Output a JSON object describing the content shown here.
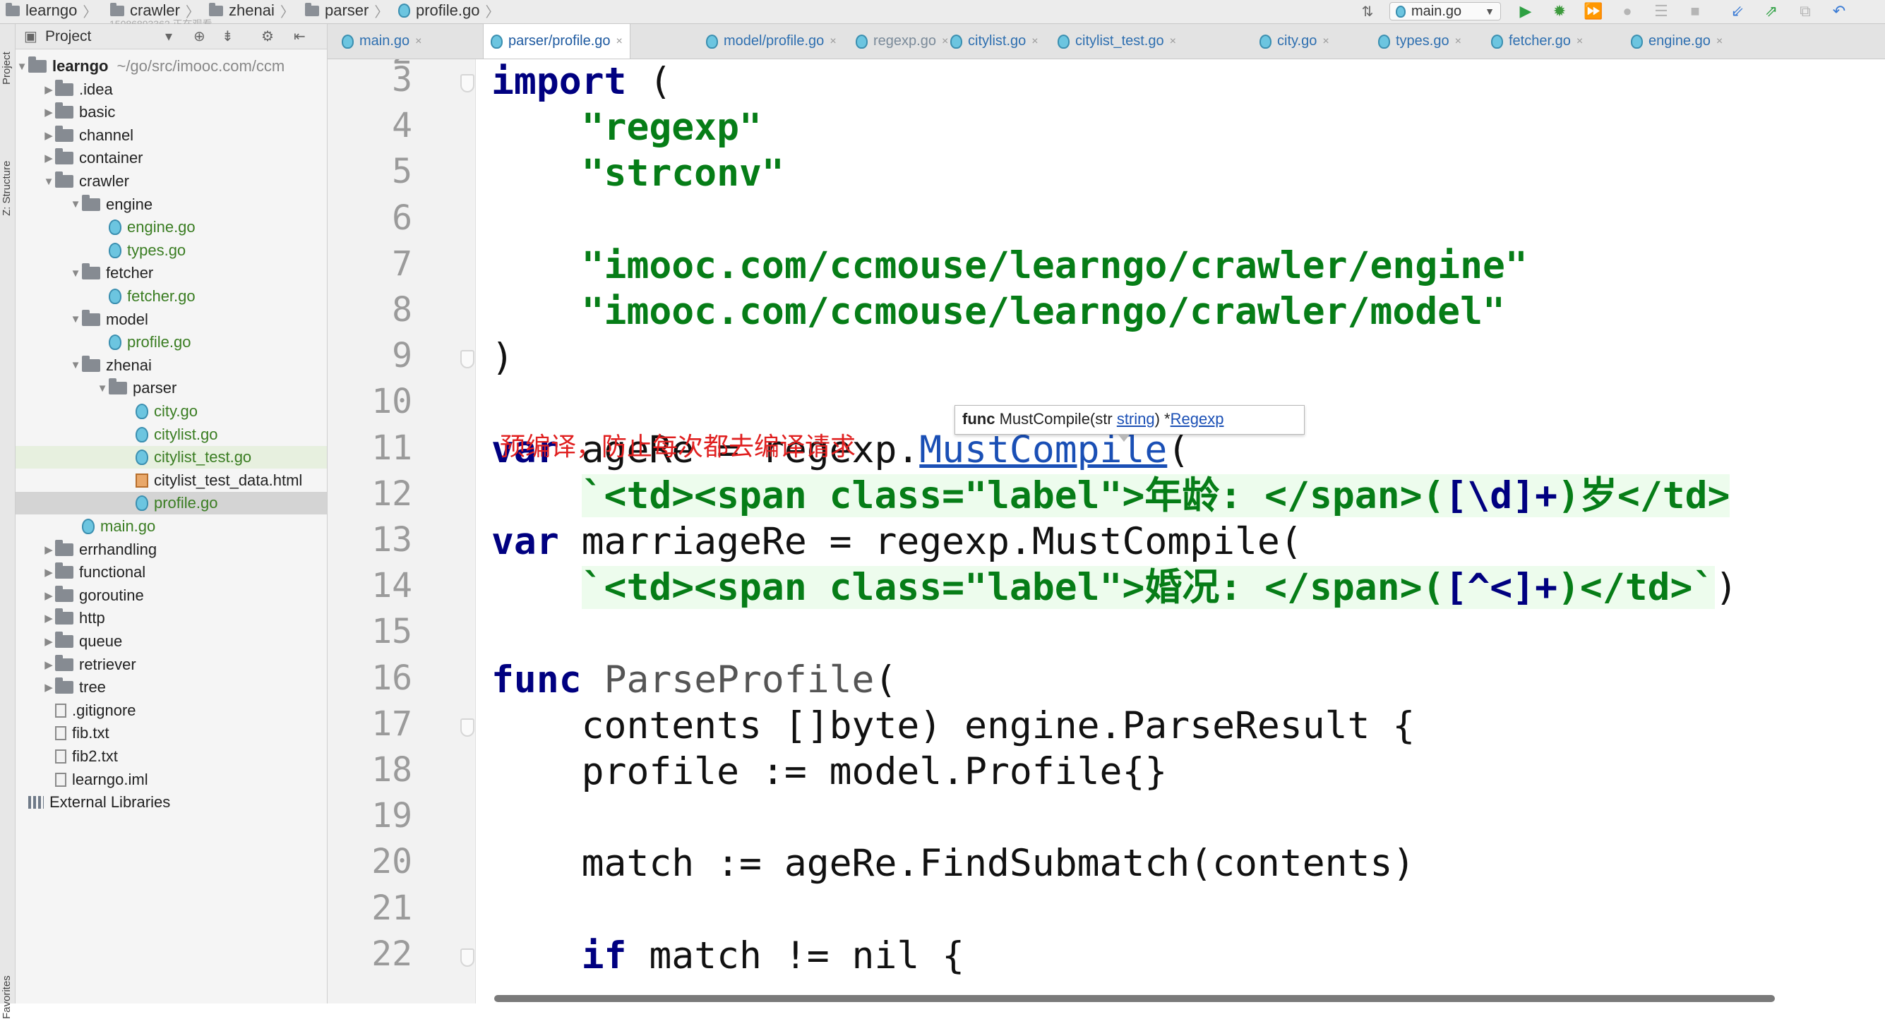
{
  "breadcrumb": {
    "items": [
      "learngo",
      "crawler",
      "zhenai",
      "parser"
    ],
    "file": "profile.go",
    "sub_text": "15086893362 正在观看"
  },
  "toolbar": {
    "run_config": "main.go",
    "buttons": [
      "run-icon",
      "debug-icon",
      "coverage-icon",
      "profile-icon",
      "build-icon",
      "stop-icon",
      "vcs-update-icon",
      "vcs-commit-icon",
      "history-icon",
      "revert-icon"
    ]
  },
  "left_strip": {
    "top_labels": [
      "Project",
      "Z: Structure"
    ],
    "bottom_label": "Favorites"
  },
  "project_panel": {
    "title": "Project",
    "tree": [
      {
        "label": "learngo",
        "extra": "~/go/src/imooc.com/ccm",
        "type": "root",
        "depth": 0,
        "expanded": true
      },
      {
        "label": ".idea",
        "type": "folder",
        "depth": 1,
        "expanded": false
      },
      {
        "label": "basic",
        "type": "folder",
        "depth": 1,
        "expanded": false
      },
      {
        "label": "channel",
        "type": "folder",
        "depth": 1,
        "expanded": false
      },
      {
        "label": "container",
        "type": "folder",
        "depth": 1,
        "expanded": false
      },
      {
        "label": "crawler",
        "type": "folder",
        "depth": 1,
        "expanded": true
      },
      {
        "label": "engine",
        "type": "folder",
        "depth": 2,
        "expanded": true
      },
      {
        "label": "engine.go",
        "type": "go",
        "depth": 3
      },
      {
        "label": "types.go",
        "type": "go",
        "depth": 3
      },
      {
        "label": "fetcher",
        "type": "folder",
        "depth": 2,
        "expanded": true
      },
      {
        "label": "fetcher.go",
        "type": "go",
        "depth": 3
      },
      {
        "label": "model",
        "type": "folder",
        "depth": 2,
        "expanded": true
      },
      {
        "label": "profile.go",
        "type": "go",
        "depth": 3
      },
      {
        "label": "zhenai",
        "type": "folder",
        "depth": 2,
        "expanded": true
      },
      {
        "label": "parser",
        "type": "folder",
        "depth": 3,
        "expanded": true
      },
      {
        "label": "city.go",
        "type": "go",
        "depth": 4
      },
      {
        "label": "citylist.go",
        "type": "go",
        "depth": 4
      },
      {
        "label": "citylist_test.go",
        "type": "go",
        "depth": 4,
        "highlight": true
      },
      {
        "label": "citylist_test_data.html",
        "type": "html",
        "depth": 4
      },
      {
        "label": "profile.go",
        "type": "go",
        "depth": 4,
        "selected": true
      },
      {
        "label": "main.go",
        "type": "go",
        "depth": 2
      },
      {
        "label": "errhandling",
        "type": "folder",
        "depth": 1,
        "expanded": false
      },
      {
        "label": "functional",
        "type": "folder",
        "depth": 1,
        "expanded": false
      },
      {
        "label": "goroutine",
        "type": "folder",
        "depth": 1,
        "expanded": false
      },
      {
        "label": "http",
        "type": "folder",
        "depth": 1,
        "expanded": false
      },
      {
        "label": "queue",
        "type": "folder",
        "depth": 1,
        "expanded": false
      },
      {
        "label": "retriever",
        "type": "folder",
        "depth": 1,
        "expanded": false
      },
      {
        "label": "tree",
        "type": "folder",
        "depth": 1,
        "expanded": false
      },
      {
        "label": ".gitignore",
        "type": "file",
        "depth": 1
      },
      {
        "label": "fib.txt",
        "type": "file",
        "depth": 1
      },
      {
        "label": "fib2.txt",
        "type": "file",
        "depth": 1
      },
      {
        "label": "learngo.iml",
        "type": "file",
        "depth": 1
      },
      {
        "label": "External Libraries",
        "type": "lib",
        "depth": 0
      }
    ]
  },
  "tabs": [
    {
      "label": "main.go"
    },
    {
      "label": "parser/profile.go",
      "active": true
    },
    {
      "label": "model/profile.go"
    },
    {
      "label": "regexp.go"
    },
    {
      "label": "citylist.go"
    },
    {
      "label": "citylist_test.go"
    },
    {
      "label": "city.go"
    },
    {
      "label": "types.go"
    },
    {
      "label": "fetcher.go"
    },
    {
      "label": "engine.go"
    }
  ],
  "editor": {
    "partial_top_line": "2",
    "line_numbers": [
      "3",
      "4",
      "5",
      "6",
      "7",
      "8",
      "9",
      "10",
      "11",
      "12",
      "13",
      "14",
      "15",
      "16",
      "17",
      "18",
      "19",
      "20",
      "21",
      "22"
    ],
    "annotation_comment": "预编译，防止每次都去编译请求",
    "tooltip": {
      "prefix": "func",
      "name": " MustCompile(str ",
      "param_type": "string",
      "mid": ") *",
      "return_type": "Regexp"
    },
    "lines": [
      {
        "n": "3",
        "parts": [
          {
            "t": "import",
            "c": "kw"
          },
          {
            "t": " (",
            "c": ""
          }
        ]
      },
      {
        "n": "4",
        "parts": [
          {
            "t": "    ",
            "c": ""
          },
          {
            "t": "\"regexp\"",
            "c": "str"
          }
        ]
      },
      {
        "n": "5",
        "parts": [
          {
            "t": "    ",
            "c": ""
          },
          {
            "t": "\"strconv\"",
            "c": "str"
          }
        ]
      },
      {
        "n": "6",
        "parts": []
      },
      {
        "n": "7",
        "parts": [
          {
            "t": "    ",
            "c": ""
          },
          {
            "t": "\"imooc.com/ccmouse/learngo/crawler/engine\"",
            "c": "str"
          }
        ]
      },
      {
        "n": "8",
        "parts": [
          {
            "t": "    ",
            "c": ""
          },
          {
            "t": "\"imooc.com/ccmouse/learngo/crawler/model\"",
            "c": "str"
          }
        ]
      },
      {
        "n": "9",
        "parts": [
          {
            "t": ")",
            "c": ""
          }
        ]
      },
      {
        "n": "10",
        "parts": []
      },
      {
        "n": "11",
        "parts": [
          {
            "t": "var",
            "c": "kw"
          },
          {
            "t": " ageRe = regexp.",
            "c": ""
          },
          {
            "t": "MustCompile",
            "c": "link"
          },
          {
            "t": "(",
            "c": ""
          }
        ]
      },
      {
        "n": "12",
        "parts": [
          {
            "t": "    ",
            "c": ""
          },
          {
            "t": "`<td><span class=\"label\">年龄: </span>(",
            "c": "str strbg"
          },
          {
            "t": "[\\d]+",
            "c": "kw strbg"
          },
          {
            "t": ")岁</td>",
            "c": "str strbg"
          }
        ]
      },
      {
        "n": "13",
        "parts": [
          {
            "t": "var",
            "c": "kw"
          },
          {
            "t": " marriageRe = regexp.MustCompile(",
            "c": ""
          }
        ]
      },
      {
        "n": "14",
        "parts": [
          {
            "t": "    ",
            "c": ""
          },
          {
            "t": "`<td><span class=\"label\">婚况: </span>(",
            "c": "str strbg"
          },
          {
            "t": "[^<]+",
            "c": "kw strbg"
          },
          {
            "t": ")</td>`",
            "c": "str strbg"
          },
          {
            "t": ")",
            "c": ""
          }
        ]
      },
      {
        "n": "15",
        "parts": []
      },
      {
        "n": "16",
        "parts": [
          {
            "t": "func",
            "c": "kw"
          },
          {
            "t": " ",
            "c": ""
          },
          {
            "t": "ParseProfile",
            "c": "fn-decl"
          },
          {
            "t": "(",
            "c": ""
          }
        ]
      },
      {
        "n": "17",
        "parts": [
          {
            "t": "    contents []byte) engine.ParseResult {",
            "c": ""
          }
        ]
      },
      {
        "n": "18",
        "parts": [
          {
            "t": "    profile := model.Profile{}",
            "c": ""
          }
        ]
      },
      {
        "n": "19",
        "parts": []
      },
      {
        "n": "20",
        "parts": [
          {
            "t": "    match := ageRe.FindSubmatch(contents)",
            "c": ""
          }
        ]
      },
      {
        "n": "21",
        "parts": []
      },
      {
        "n": "22",
        "parts": [
          {
            "t": "    ",
            "c": ""
          },
          {
            "t": "if",
            "c": "kw"
          },
          {
            "t": " match != nil {",
            "c": ""
          }
        ]
      }
    ]
  },
  "colors": {
    "keyword": "#000080",
    "string": "#067d17",
    "string_bg": "#edfced",
    "comment_red": "#e02020",
    "link": "#1a4fb5"
  }
}
